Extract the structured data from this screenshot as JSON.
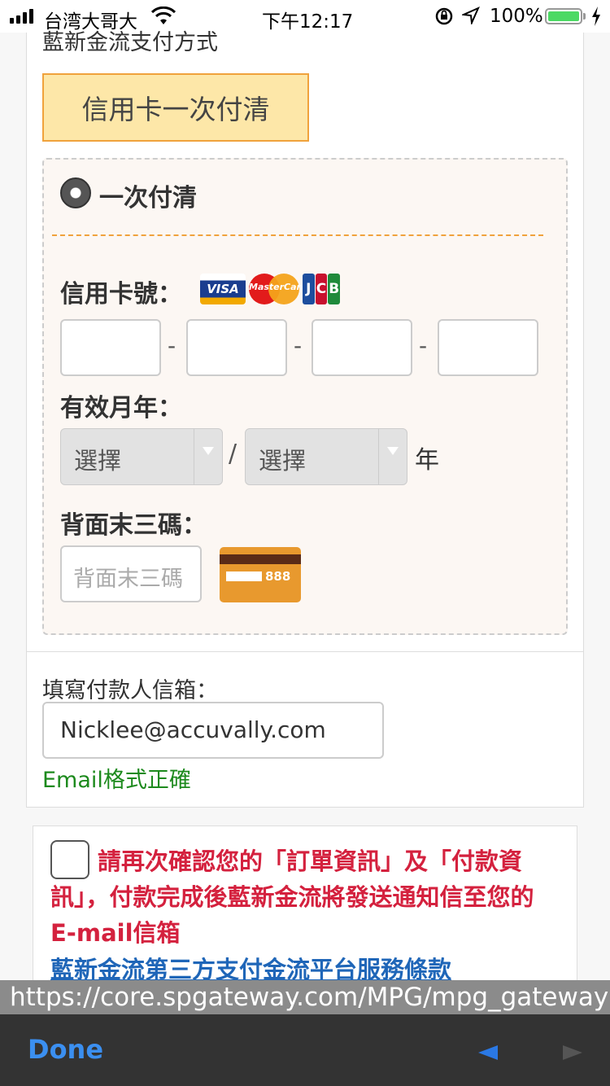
{
  "status_bar": {
    "carrier": "台湾大哥大",
    "time": "下午12:17",
    "battery": "100%",
    "battery_level": 1.0,
    "icons": [
      "signal-icon",
      "wifi-icon",
      "rotation-lock-icon",
      "location-icon",
      "battery-icon",
      "charging-icon"
    ]
  },
  "page": {
    "section_title": "藍新金流支付方式",
    "payment_tab": "信用卡一次付清",
    "payment_option": "一次付清",
    "card_number_label": "信用卡號：",
    "card_brands": [
      "VISA",
      "MasterCard",
      "JCB"
    ],
    "card_separator": "-",
    "expiry_label": "有效月年：",
    "month_select": "選擇",
    "year_select": "選擇",
    "expiry_slash": "/",
    "year_suffix": "年",
    "cvv_label": "背面末三碼：",
    "cvv_placeholder": "背面末三碼",
    "cvv_icon_number": "888",
    "email_label": "填寫付款人信箱：",
    "email_value": "Nicklee@accuvally.com",
    "email_status": "Email格式正確",
    "confirm_text": "請再次確認您的「訂單資訊」及「付款資訊」，付款完成後藍新金流將發送通知信至您的E-mail信箱",
    "terms_link": "藍新金流第三方支付金流平台服務條款"
  },
  "browser": {
    "url": "https://core.spgateway.com/MPG/mpg_gateway",
    "done": "Done"
  },
  "colors": {
    "tab_bg": "#fde7a8",
    "tab_border": "#f0a23c",
    "confirm_red": "#d4213e",
    "link_blue": "#1f66b8",
    "ok_green": "#1d8a1d",
    "done_blue": "#3b8ff0"
  }
}
